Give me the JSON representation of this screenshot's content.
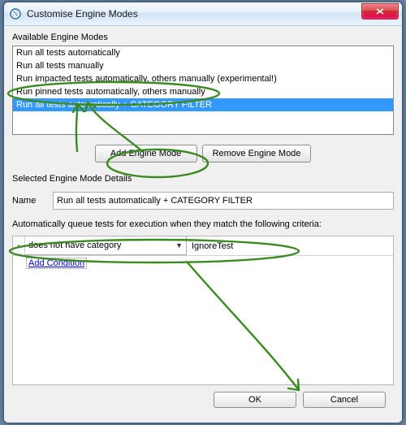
{
  "window": {
    "title": "Customise Engine Modes"
  },
  "available_modes": {
    "label": "Available Engine Modes",
    "items": [
      "Run all tests automatically",
      "Run all tests manually",
      "Run impacted tests automatically, others manually (experimental!)",
      "Run pinned tests automatically, others manually",
      "Run all tests automatically + CATEGORY FILTER"
    ],
    "selected_index": 4
  },
  "buttons": {
    "add_mode": "Add Engine Mode",
    "remove_mode": "Remove Engine Mode",
    "ok": "OK",
    "cancel": "Cancel"
  },
  "details": {
    "section_label": "Selected Engine Mode Details",
    "name_label": "Name",
    "name_value": "Run all tests automatically + CATEGORY FILTER",
    "criteria_label": "Automatically queue tests for execution when they match the following criteria:",
    "condition": {
      "operator": "does not have category",
      "value": "IgnoreTest"
    },
    "add_condition": "Add Condition"
  },
  "annotation_color": "#3a8a1f"
}
